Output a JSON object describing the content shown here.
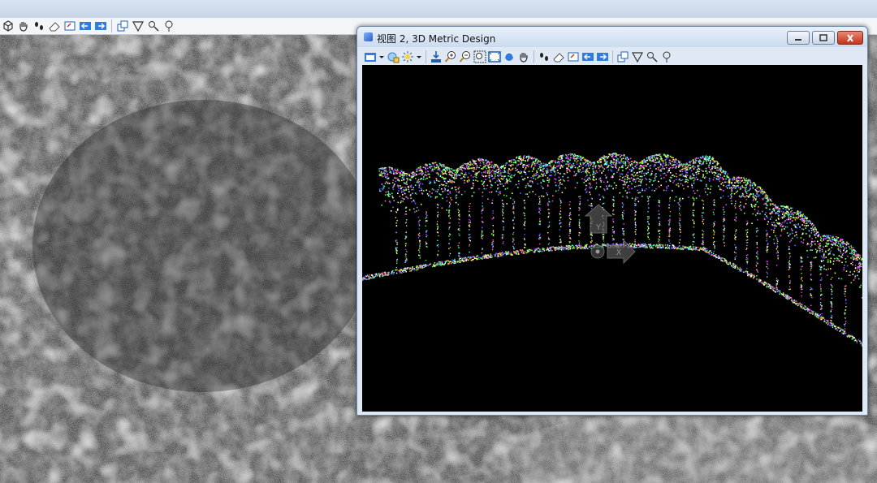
{
  "window": {
    "title": "视图 2, 3D Metric Design",
    "controls": [
      "minimize",
      "maximize",
      "close"
    ]
  },
  "main_toolbar": {
    "icons": [
      "view-cube-icon",
      "pan-hand-icon",
      "walk-footprint-icon",
      "eraser-icon",
      "view-previous-icon",
      "view-back-icon",
      "view-forward-icon",
      "copy-view-icon",
      "clip-volume-icon",
      "clip-mask-icon",
      "marker-icon"
    ]
  },
  "view_toolbar": {
    "icons": [
      "view-attributes-icon",
      "dropdown-icon",
      "display-style-icon",
      "lighting-icon",
      "dropdown-icon",
      "update-view-icon",
      "zoom-in-icon",
      "zoom-out-icon",
      "window-area-icon",
      "fit-view-icon",
      "rotate-view-icon",
      "pan-view-icon",
      "walk-footprint-icon",
      "eraser-icon",
      "view-previous-icon",
      "view-back-icon",
      "view-forward-icon",
      "copy-view-icon",
      "clip-volume-icon",
      "clip-mask-icon",
      "marker-icon"
    ]
  },
  "colors": {
    "titlebar": "#cbdbee",
    "canvas": "#000000",
    "close_button": "#c4321c"
  }
}
